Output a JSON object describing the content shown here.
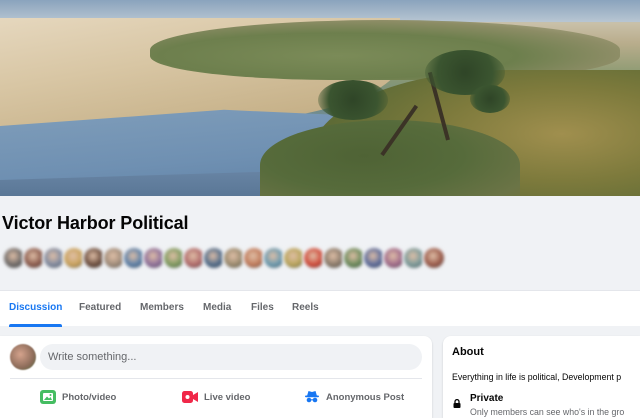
{
  "group": {
    "name": "Victor Harbor Political"
  },
  "member_avatars": [
    "#6e6a68",
    "#8a5a4c",
    "#7f8aa0",
    "#c9a25c",
    "#6b4d3e",
    "#a08c7a",
    "#5a7fa8",
    "#8e6f9a",
    "#7d9a5e",
    "#b06a6a",
    "#4f6b8a",
    "#9a8a6e",
    "#c07a5a",
    "#6a9ab0",
    "#b8a45a",
    "#d04a3a",
    "#8a7a6a",
    "#6a8a5a",
    "#5a6a9a",
    "#a06a8a",
    "#7a9a9a",
    "#9a5a4a"
  ],
  "tabs": [
    {
      "label": "Discussion",
      "active": true
    },
    {
      "label": "Featured",
      "active": false
    },
    {
      "label": "Members",
      "active": false
    },
    {
      "label": "Media",
      "active": false
    },
    {
      "label": "Files",
      "active": false
    },
    {
      "label": "Reels",
      "active": false
    }
  ],
  "composer": {
    "placeholder": "Write something...",
    "actions": [
      {
        "label": "Photo/video",
        "icon": "photo-icon",
        "color": "#45bd62"
      },
      {
        "label": "Live video",
        "icon": "live-video-icon",
        "color": "#f02849"
      },
      {
        "label": "Anonymous Post",
        "icon": "anonymous-icon",
        "color": "#1877f2"
      }
    ]
  },
  "about": {
    "heading": "About",
    "description": "Everything in life is political, Development p",
    "privacy_label": "Private",
    "privacy_detail": "Only members can see who's in the gro"
  },
  "colors": {
    "accent": "#1877f2",
    "background": "#f0f2f5"
  }
}
